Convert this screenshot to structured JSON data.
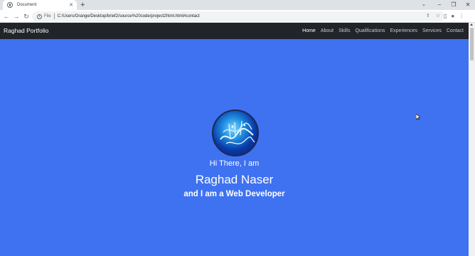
{
  "browser": {
    "tab_title": "Document",
    "tab_close": "✕",
    "new_tab": "+",
    "tabs_menu": "⌄",
    "win_min": "–",
    "win_max": "❐",
    "win_close": "✕",
    "back": "←",
    "forward": "→",
    "reload": "↻",
    "info": "i",
    "scheme": "File",
    "url": "C:/Users/Orange/Desktop/brief2/source%20code/project2html.html#contact",
    "share_icon": "⇪",
    "bookmark_icon": "☆",
    "sidepanel_icon": "▯",
    "profile_icon": "●",
    "menu_icon": "⋮"
  },
  "navbar": {
    "brand": "Raghad Portfolio",
    "links": [
      {
        "label": "Home",
        "active": true
      },
      {
        "label": "About"
      },
      {
        "label": "Skills"
      },
      {
        "label": "Qualifications"
      },
      {
        "label": "Experiences"
      },
      {
        "label": "Services"
      },
      {
        "label": "Contact"
      }
    ]
  },
  "hero": {
    "greeting": "Hi There, I am",
    "name": "Raghad Naser",
    "role": "and I am a Web Developer"
  },
  "colors": {
    "hero_bg": "#3f72f1",
    "navbar_bg": "#212529"
  }
}
